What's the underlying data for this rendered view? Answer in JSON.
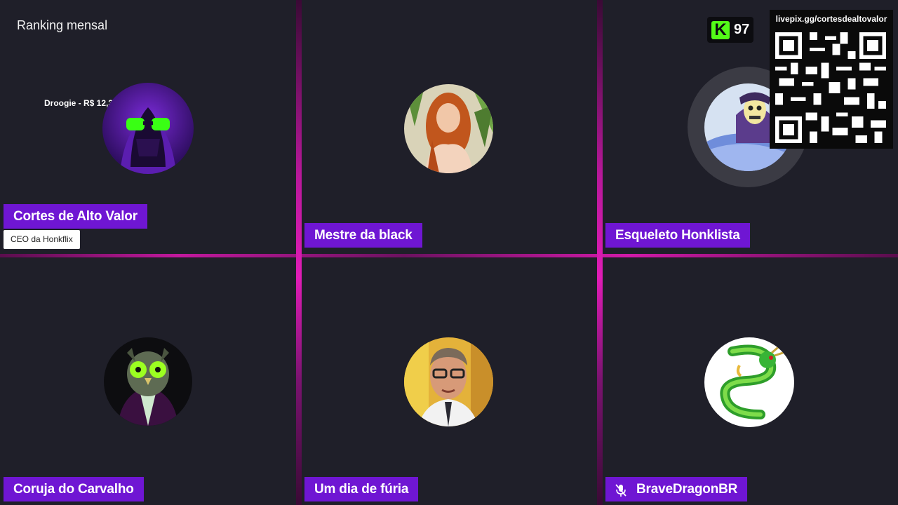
{
  "header": {
    "ranking_title": "Ranking mensal",
    "donation_text": "Droogie - R$ 12,34"
  },
  "kick_badge": {
    "letter": "K",
    "viewer_count": "97",
    "brand_color": "#53fc18"
  },
  "livepix": {
    "url": "livepix.gg/cortesdealtovalor"
  },
  "participants": [
    {
      "name": "Cortes de Alto Valor",
      "subtitle": "CEO da Honkflix",
      "avatar": "purple-hooded-figure-green-goggles"
    },
    {
      "name": "Mestre da black",
      "avatar": "redhead-woman-photo"
    },
    {
      "name": "Esqueleto Honklista",
      "avatar": "skeletor-in-bed",
      "speaking": true
    },
    {
      "name": "Coruja do Carvalho",
      "avatar": "owl-in-suit-green-goggles"
    },
    {
      "name": "Um dia de fúria",
      "avatar": "man-with-glasses-photo"
    },
    {
      "name": "BraveDragonBR",
      "avatar": "green-dragon-shenron",
      "muted": true,
      "status_icon": "mic-muted-icon"
    }
  ],
  "colors": {
    "background": "#1f1f29",
    "name_tag": "#6f16d3",
    "divider": "#d11aa8"
  }
}
